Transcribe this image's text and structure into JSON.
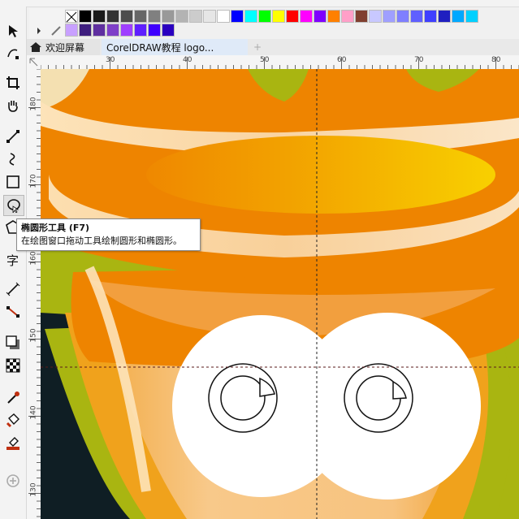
{
  "tabs": {
    "welcome": "欢迎屏幕",
    "document": "CorelDRAW教程 logo...",
    "add": "+"
  },
  "ruler_top": [
    "30",
    "40",
    "50",
    "60",
    "70",
    "80"
  ],
  "ruler_left": [
    "180",
    "170",
    "160",
    "150",
    "140",
    "130"
  ],
  "tooltip": {
    "title": "椭圆形工具 (F7)",
    "description": "在绘图窗口拖动工具绘制圆形和椭圆形。"
  },
  "palette": {
    "row1": [
      "none",
      "#000000",
      "#1a1a1a",
      "#333333",
      "#4d4d4d",
      "#666666",
      "#808080",
      "#999999",
      "#b3b3b3",
      "#cccccc",
      "#e6e6e6",
      "#ffffff",
      "#0000ff",
      "#00ffff",
      "#00ff00",
      "#ffff00",
      "#ff0000",
      "#ff00ff",
      "#7f00ff",
      "#ff8000",
      "#ff9fc8",
      "#803f2f",
      "#c8c8ff",
      "#9f9fff",
      "#7f7fff",
      "#5f5fff",
      "#3f3fff",
      "#1f1fc0",
      "#00a8ff",
      "#00d0ff"
    ],
    "row2": [
      "#c8a0ff",
      "#3f1f7f",
      "#5f2fa0",
      "#7f3fc8",
      "#9f3fff",
      "#5f1fff",
      "#3f00ff",
      "#2a00c0"
    ]
  },
  "colors": {
    "accent_tab": "#dfeaf8",
    "canvas_bg": "#0f1e24",
    "orange": "#ee8400",
    "light_orange": "#f6c37f",
    "green": "#a9b511",
    "yellow": "#f5c800",
    "eye_white": "#ffffff",
    "guide": "#4a1a1a"
  }
}
